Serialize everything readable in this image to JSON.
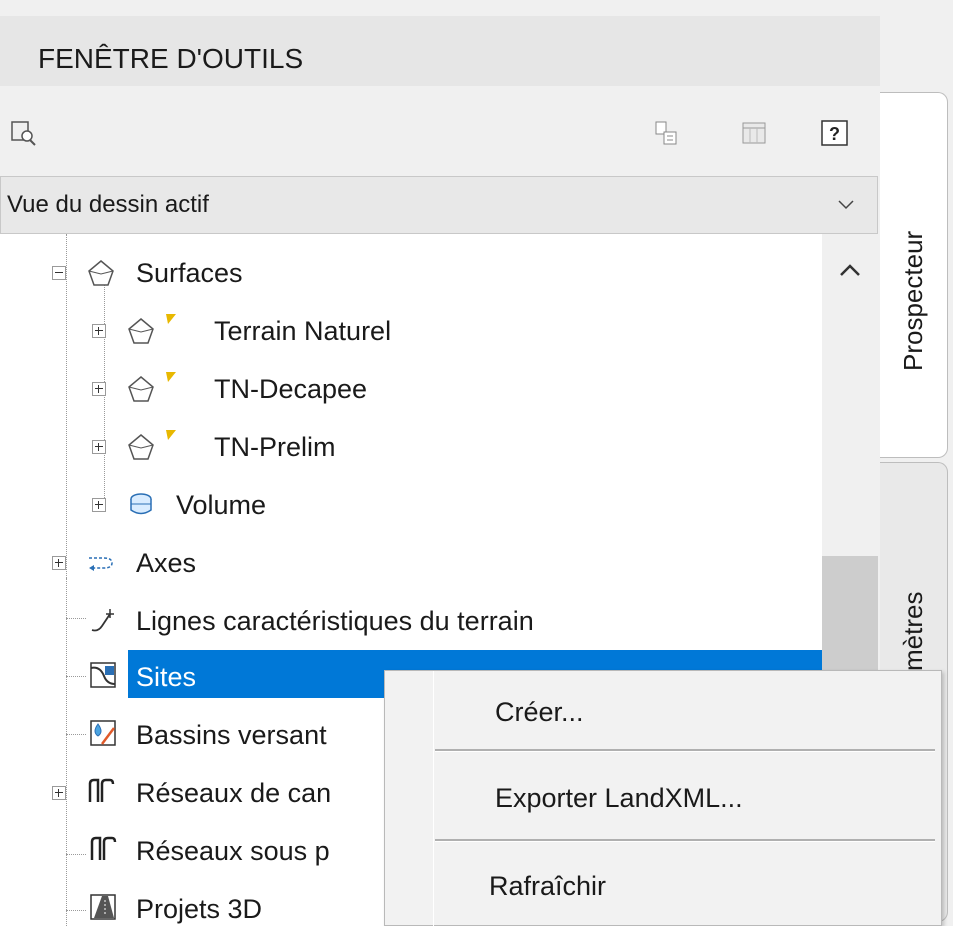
{
  "header": {
    "title": "FENÊTRE D'OUTILS"
  },
  "toolbar": {
    "buttons": [
      {
        "icon": "zoom-to-object-icon"
      },
      {
        "icon": "copy-properties-icon"
      },
      {
        "icon": "table-view-icon"
      },
      {
        "icon": "help-icon",
        "label": "?"
      }
    ]
  },
  "view_select": {
    "value": "Vue du dessin actif"
  },
  "tree": {
    "surfaces": "Surfaces",
    "terrain_naturel": "Terrain Naturel",
    "tn_decapee": "TN-Decapee",
    "tn_prelim": "TN-Prelim",
    "volume": "Volume",
    "axes": "Axes",
    "lignes": "Lignes caractéristiques du terrain",
    "sites": "Sites",
    "bassins": "Bassins versant",
    "reseaux_can": "Réseaux de can",
    "reseaux_sous": "Réseaux sous p",
    "projets3d": "Projets 3D"
  },
  "side_tabs": {
    "prospecteur": "Prospecteur",
    "parametres": "mètres"
  },
  "context_menu": {
    "items": [
      "Créer...",
      "Exporter LandXML...",
      "Rafraîchir"
    ]
  },
  "colors": {
    "selection": "#0078d7",
    "warning_flag": "#e8b800"
  }
}
